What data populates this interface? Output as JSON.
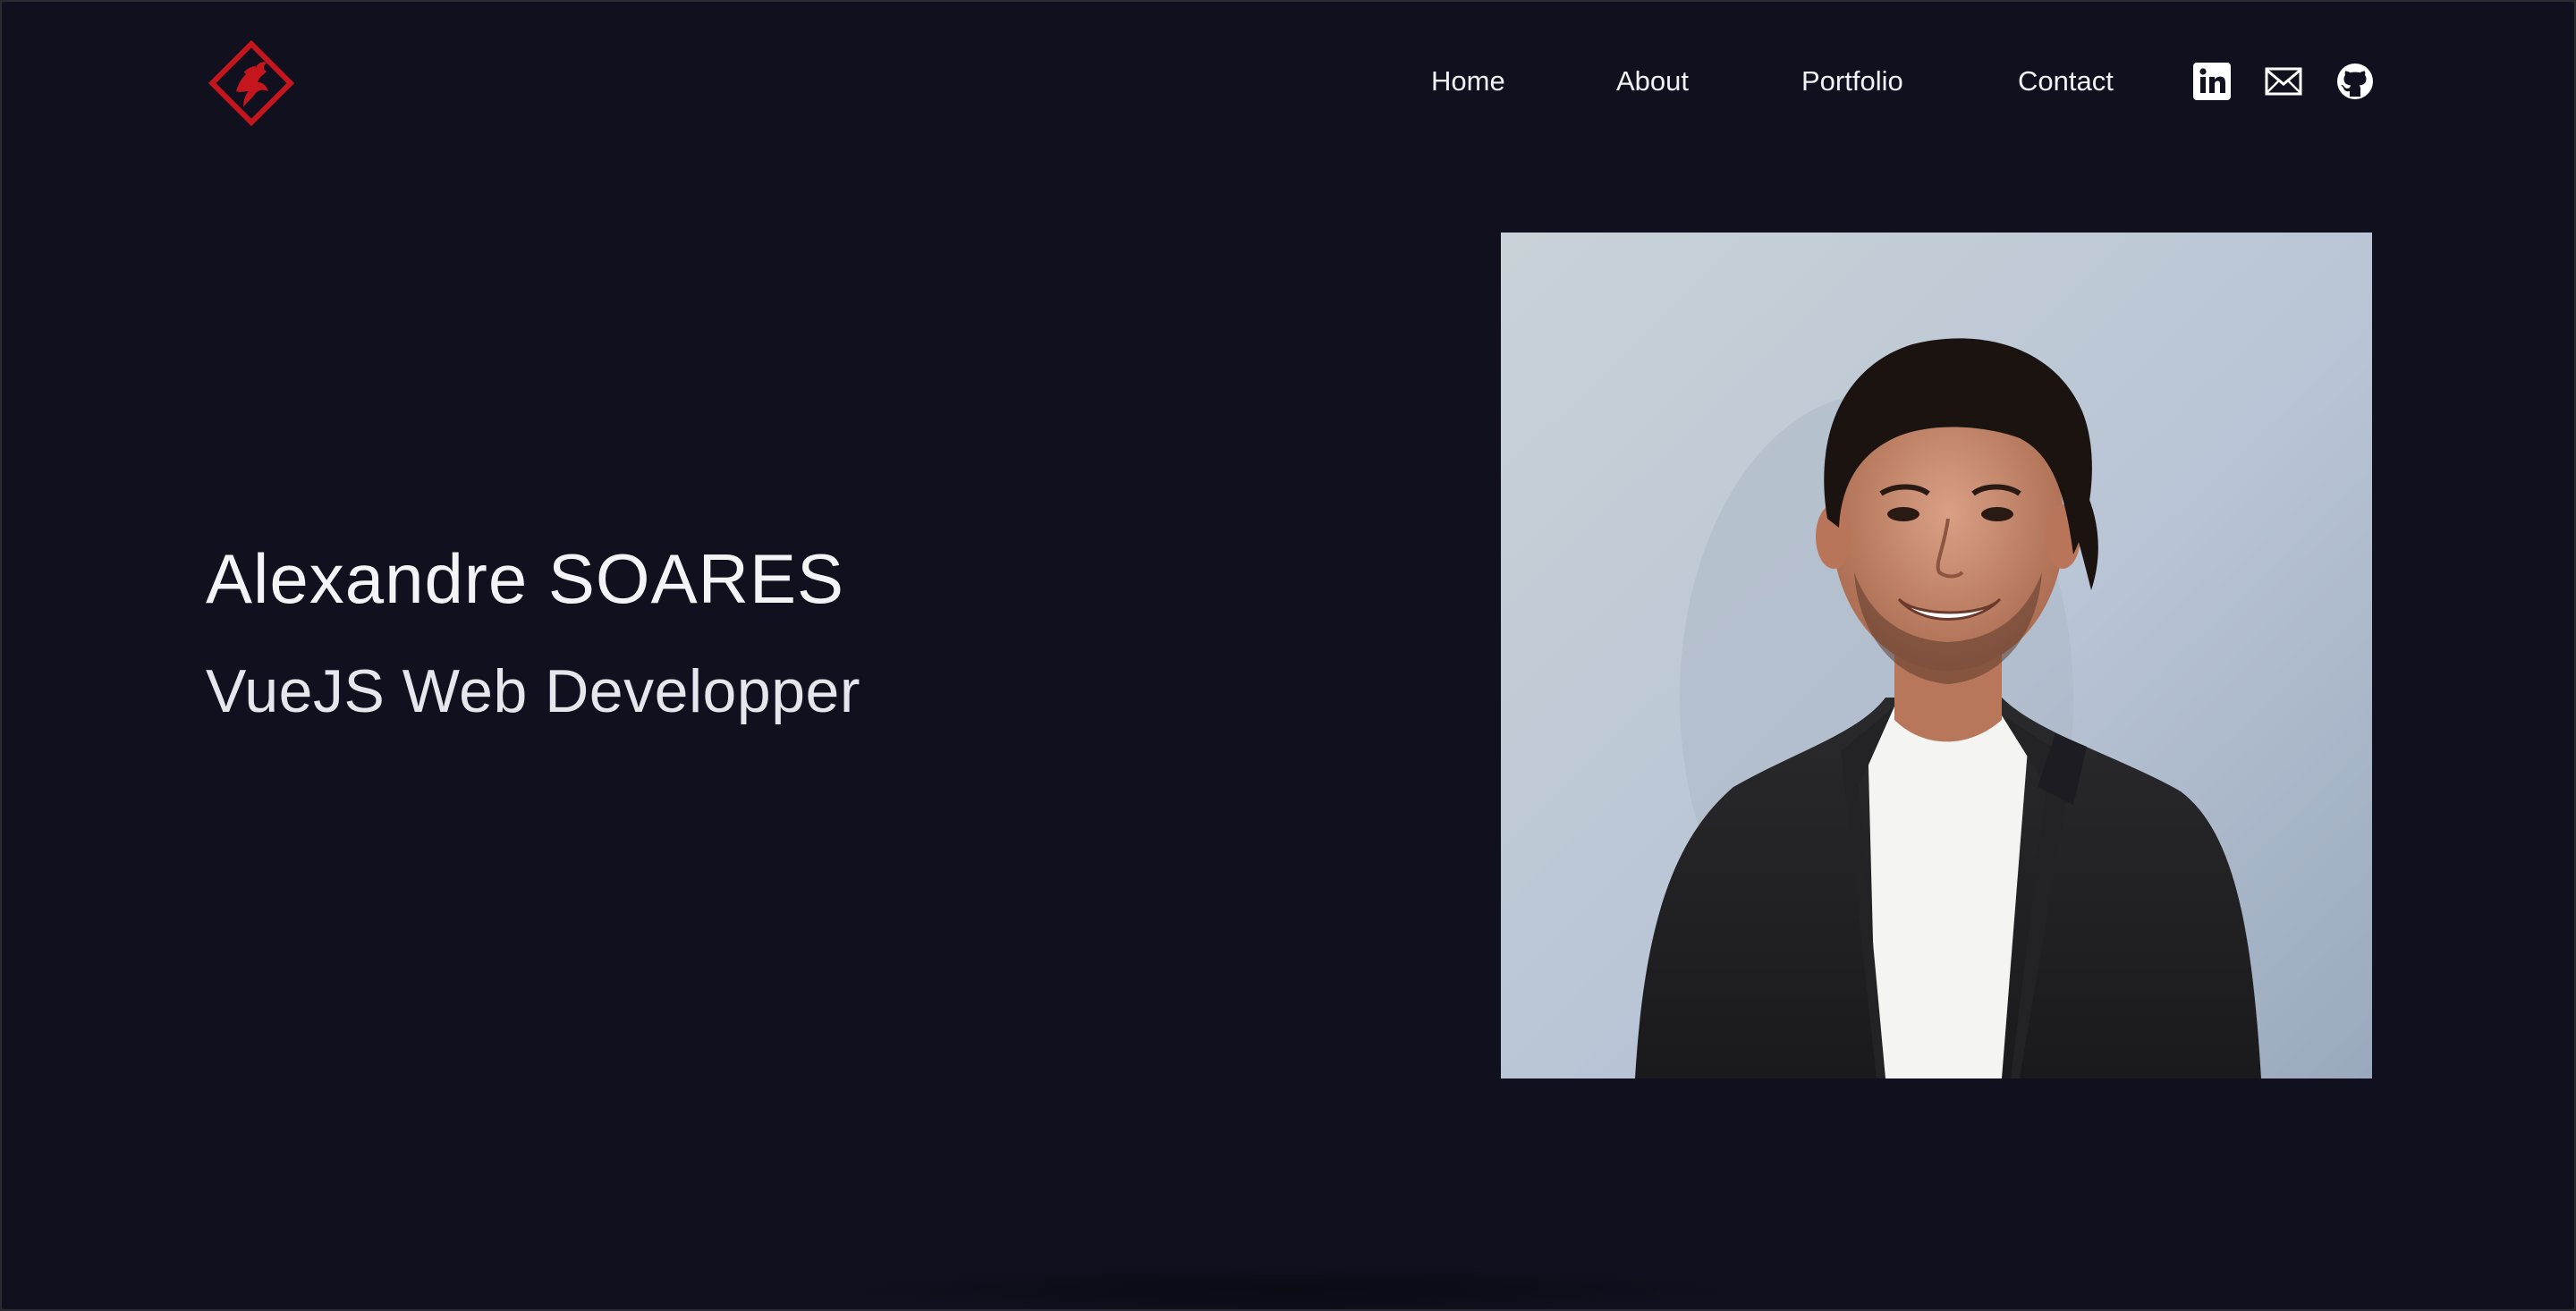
{
  "nav": {
    "items": [
      {
        "label": "Home"
      },
      {
        "label": "About"
      },
      {
        "label": "Portfolio"
      },
      {
        "label": "Contact"
      }
    ],
    "social": [
      {
        "icon": "linkedin-icon"
      },
      {
        "icon": "mail-icon"
      },
      {
        "icon": "github-icon"
      }
    ]
  },
  "hero": {
    "name": "Alexandre SOARES",
    "role": "VueJS Web Developper"
  },
  "colors": {
    "background": "#10101f",
    "text": "#f2f2f5",
    "logo_red": "#c4161c"
  }
}
